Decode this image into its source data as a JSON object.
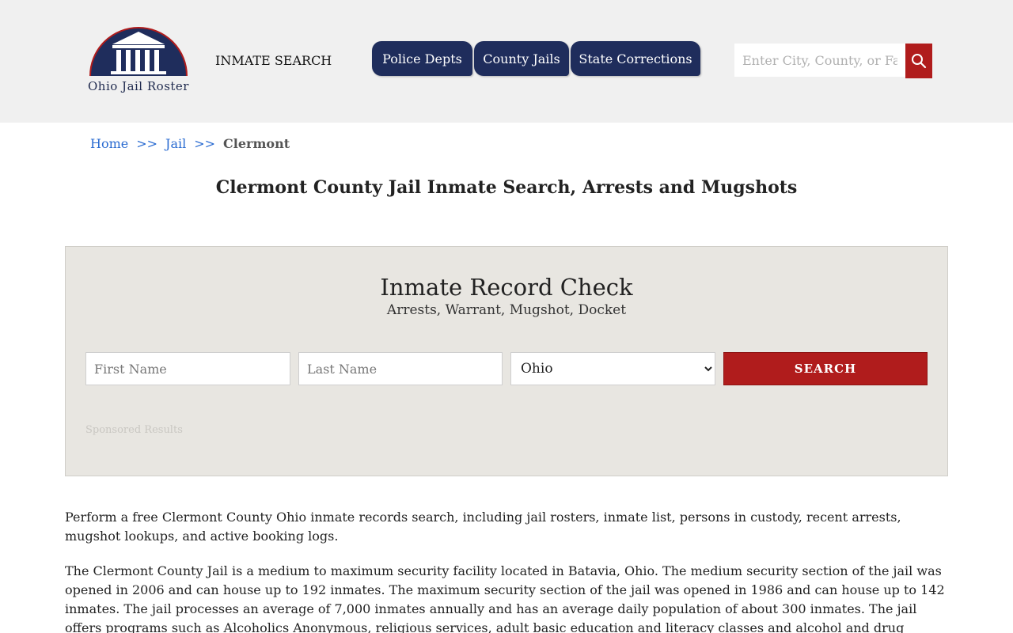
{
  "header": {
    "logo_text": "Ohio Jail Roster",
    "inmate_search_link": "INMATE SEARCH",
    "nav": [
      {
        "label": "Police Depts"
      },
      {
        "label": "County Jails"
      },
      {
        "label": "State Corrections"
      }
    ],
    "search": {
      "placeholder": "Enter City, County, or Facility"
    }
  },
  "breadcrumb": {
    "home": "Home",
    "sep1": ">>",
    "jail": "Jail",
    "sep2": ">>",
    "current": "Clermont"
  },
  "page_title": "Clermont County Jail Inmate Search, Arrests and Mugshots",
  "record_check": {
    "title": "Inmate Record Check",
    "subtitle": "Arrests, Warrant, Mugshot, Docket",
    "first_name_placeholder": "First Name",
    "last_name_placeholder": "Last Name",
    "state_selected": "Ohio",
    "search_label": "SEARCH",
    "sponsored": "Sponsored Results"
  },
  "content": {
    "paragraph1": "Perform a free Clermont County Ohio inmate records search, including jail rosters, inmate list, persons in custody, recent arrests, mugshot lookups, and active booking logs.",
    "paragraph2": "The Clermont County Jail is a medium to maximum security facility located in Batavia, Ohio. The medium security section of the jail was opened in 2006 and can house up to 192 inmates. The maximum security section of the jail was opened in 1986 and can house up to 142 inmates. The jail processes an average of 7,000 inmates annually and has an average daily population of about 300 inmates. The jail offers programs such as Alcoholics Anonymous, religious services, adult basic education and literacy classes and alcohol and drug education classes. All inmates housed in"
  },
  "colors": {
    "nav_blue": "#1f2d5c",
    "accent_red": "#b01c1c",
    "link_blue": "#2a6bd1"
  }
}
